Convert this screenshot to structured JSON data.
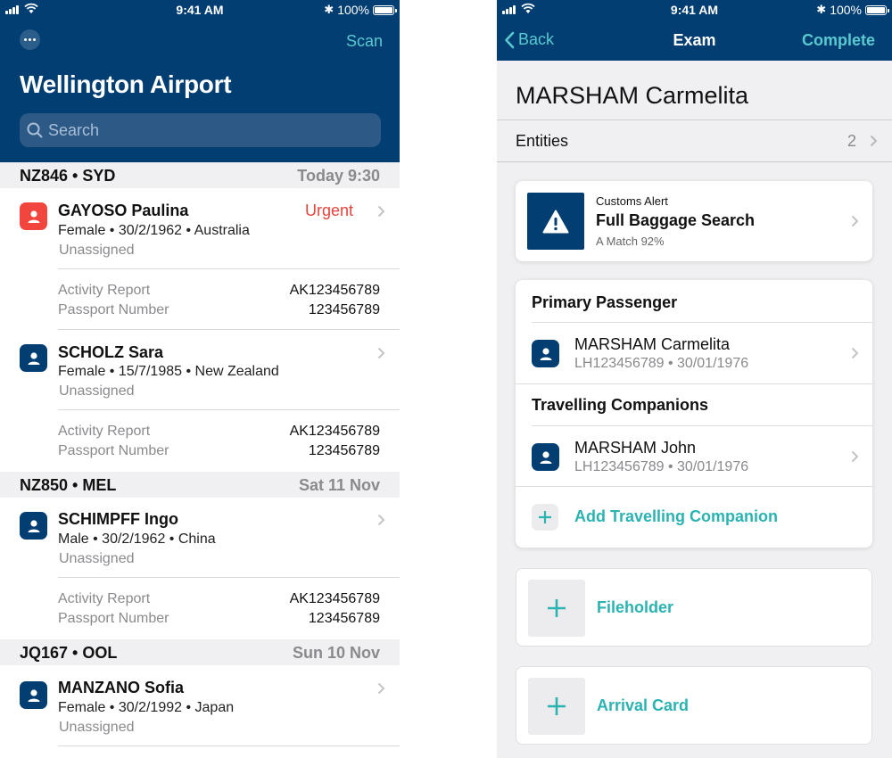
{
  "status_bar": {
    "time": "9:41 AM",
    "battery": "100%",
    "battery_level": 1.0
  },
  "left_screen": {
    "header": {
      "scan_label": "Scan",
      "title": "Wellington Airport",
      "search_placeholder": "Search"
    },
    "flights": [
      {
        "code": "NZ846 • SYD",
        "date": "Today 9:30",
        "passengers": [
          {
            "name": "GAYOSO Paulina",
            "details": "Female • 30/2/1962 • Australia",
            "status": "Unassigned",
            "badge": "Urgent",
            "meta": [
              {
                "label": "Activity Report",
                "value": "AK123456789"
              },
              {
                "label": "Passport Number",
                "value": "123456789"
              }
            ]
          },
          {
            "name": "SCHOLZ Sara",
            "details": "Female • 15/7/1985 • New Zealand",
            "status": "Unassigned",
            "meta": [
              {
                "label": "Activity Report",
                "value": "AK123456789"
              },
              {
                "label": "Passport Number",
                "value": "123456789"
              }
            ]
          }
        ]
      },
      {
        "code": "NZ850 • MEL",
        "date": "Sat 11 Nov",
        "passengers": [
          {
            "name": "SCHIMPFF Ingo",
            "details": "Male • 30/2/1962 • China",
            "status": "Unassigned",
            "meta": [
              {
                "label": "Activity Report",
                "value": "AK123456789"
              },
              {
                "label": "Passport Number",
                "value": "123456789"
              }
            ]
          }
        ]
      },
      {
        "code": "JQ167 • OOL",
        "date": "Sun 10 Nov",
        "passengers": [
          {
            "name": "MANZANO Sofia",
            "details": "Female • 30/2/1992 • Japan",
            "status": "Unassigned"
          }
        ]
      }
    ]
  },
  "right_screen": {
    "nav": {
      "back_label": "Back",
      "title": "Exam",
      "complete_label": "Complete"
    },
    "person_name": "MARSHAM Carmelita",
    "entities": {
      "label": "Entities",
      "count": "2"
    },
    "alert": {
      "category": "Customs Alert",
      "title": "Full Baggage Search",
      "match": "A Match 92%"
    },
    "primary": {
      "section_title": "Primary Passenger",
      "name": "MARSHAM Carmelita",
      "sub": "LH123456789 • 30/01/1976"
    },
    "companions": {
      "section_title": "Travelling Companions",
      "items": [
        {
          "name": "MARSHAM John",
          "sub": "LH123456789 • 30/01/1976"
        }
      ],
      "add_label": "Add Travelling Companion"
    },
    "tiles": [
      {
        "label": "Fileholder"
      },
      {
        "label": "Arrival Card"
      }
    ]
  },
  "colors": {
    "navy": "#033e73",
    "teal": "#58c9cf",
    "teal_action": "#2bb3b2",
    "urgent": "#e8433c",
    "grey_text": "#8a8a8e"
  },
  "icons": [
    "more-icon",
    "search-icon",
    "person-icon",
    "chevron-right-icon",
    "chevron-left-icon",
    "warning-icon",
    "plus-icon",
    "signal-icon",
    "wifi-icon",
    "bluetooth-icon",
    "battery-icon"
  ]
}
